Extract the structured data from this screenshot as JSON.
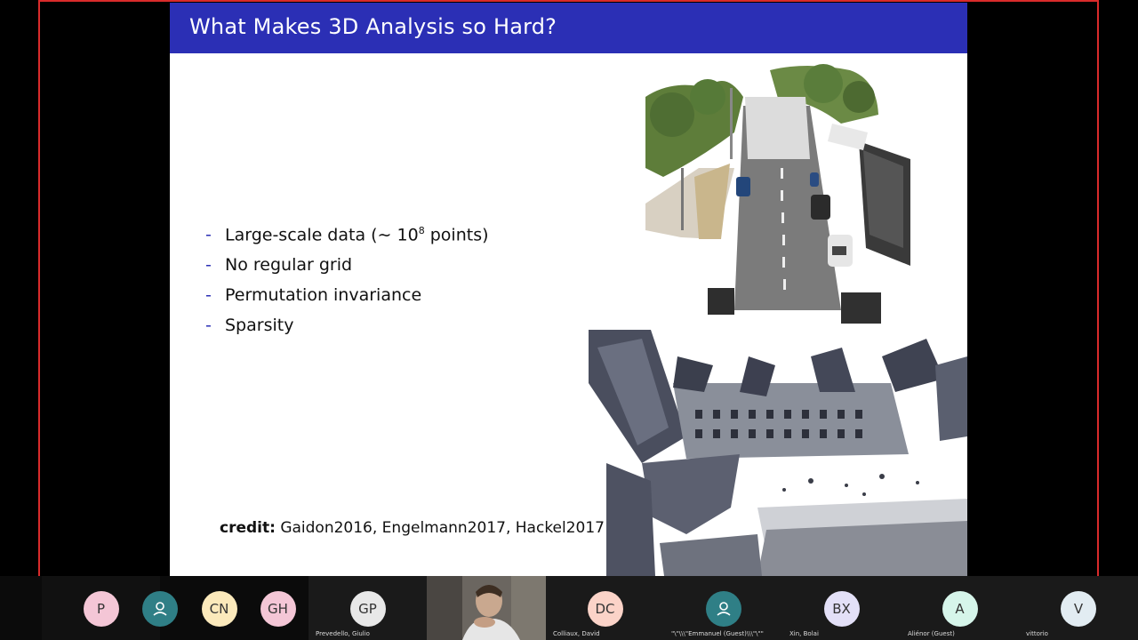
{
  "slide": {
    "title": "What Makes 3D Analysis so Hard?",
    "bullets": [
      {
        "text": "Large-scale data (∼ 10",
        "sup": "8",
        "suffix": " points)"
      },
      {
        "text": "No regular grid"
      },
      {
        "text": "Permutation invariance"
      },
      {
        "text": "Sparsity"
      }
    ],
    "bullet_marker": "-",
    "credit_label": "credit:",
    "credit_text": "Gaidon2016, Engelmann2017, Hackel2017"
  },
  "participants": [
    {
      "initials": "P",
      "color": "#f4c6d6",
      "name": ""
    },
    {
      "initials": "",
      "icon": "person-icon",
      "color": "#2f7f86",
      "name": ""
    },
    {
      "initials": "CN",
      "color": "#fbe9bb",
      "name": ""
    },
    {
      "initials": "GH",
      "color": "#f4c6d6",
      "name": ""
    },
    {
      "initials": "GP",
      "color": "#e8e8e8",
      "name": "Prevedello, Giulio"
    },
    {
      "initials": "",
      "video": true,
      "name": ""
    },
    {
      "initials": "DC",
      "color": "#fbd3c8",
      "name": "Colliaux, David"
    },
    {
      "initials": "",
      "icon": "person-icon",
      "color": "#2f7f86",
      "name": "\"\\\"\\\\\\\"Emmanuel (Guest)\\\\\\\"\\\"\""
    },
    {
      "initials": "BX",
      "color": "#e3e0f7",
      "name": "Xin, Bolai"
    },
    {
      "initials": "A",
      "color": "#d6f5ea",
      "name": "Aliénor (Guest)"
    },
    {
      "initials": "V",
      "color": "#e2ecf2",
      "name": "vittorio"
    }
  ]
}
